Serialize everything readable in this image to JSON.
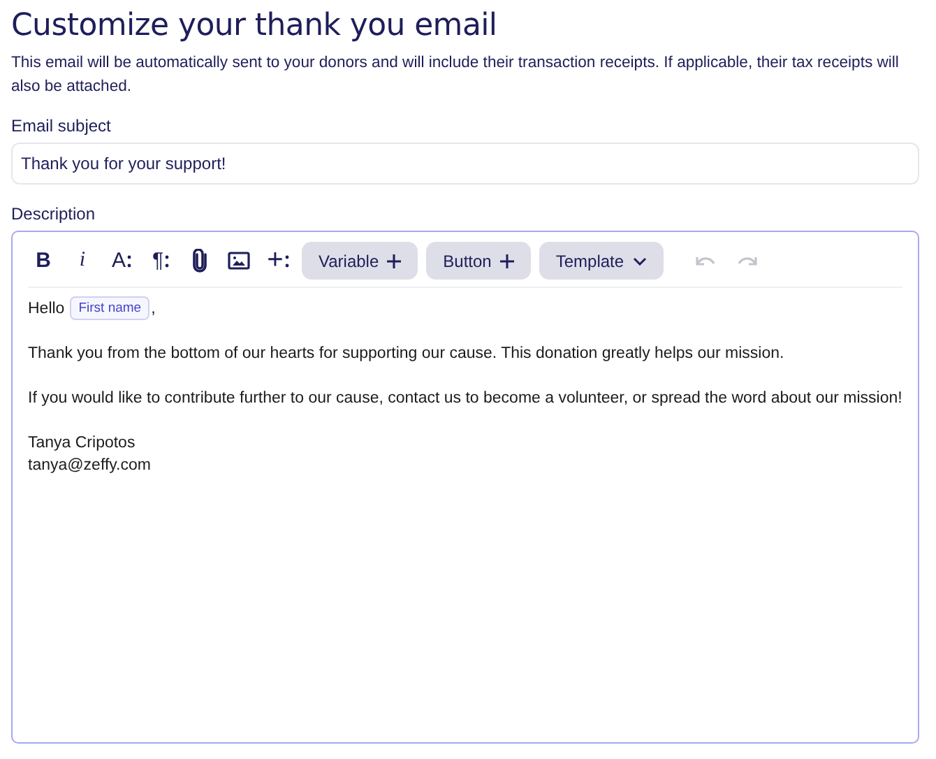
{
  "title": "Customize your thank you email",
  "intro": "This email will be automatically sent to your donors and will include their transaction receipts. If applicable, their tax receipts will also be attached.",
  "subject": {
    "label": "Email subject",
    "value": "Thank you for your support!"
  },
  "description": {
    "label": "Description",
    "tools": [
      {
        "kind": "bold",
        "glyph": "B"
      },
      {
        "kind": "italic",
        "glyph": "i"
      },
      {
        "kind": "size",
        "glyph": "A"
      },
      {
        "kind": "paragraph",
        "glyph": "¶"
      },
      {
        "kind": "attach"
      },
      {
        "kind": "image"
      },
      {
        "kind": "insert",
        "glyph": "+"
      }
    ],
    "menus": [
      {
        "label": "Variable",
        "kind": "add"
      },
      {
        "label": "Button",
        "kind": "add"
      },
      {
        "label": "Template",
        "kind": "dropdown"
      }
    ],
    "history": [
      {
        "kind": "undo",
        "disabled": true
      },
      {
        "kind": "redo",
        "disabled": true
      }
    ],
    "body": [
      {
        "kind": "greeting",
        "text": "Hello",
        "variable": "First name",
        "suffix": ","
      },
      {
        "kind": "paragraph",
        "text": "Thank you from the bottom of our hearts for supporting our cause. This donation greatly helps our mission."
      },
      {
        "kind": "paragraph",
        "text": "If you would like to contribute further to our cause, contact us to become a volunteer, or spread the word about our mission!"
      },
      {
        "kind": "signature",
        "lines": [
          "Tanya Cripotos",
          "tanya@zeffy.com"
        ]
      }
    ]
  }
}
